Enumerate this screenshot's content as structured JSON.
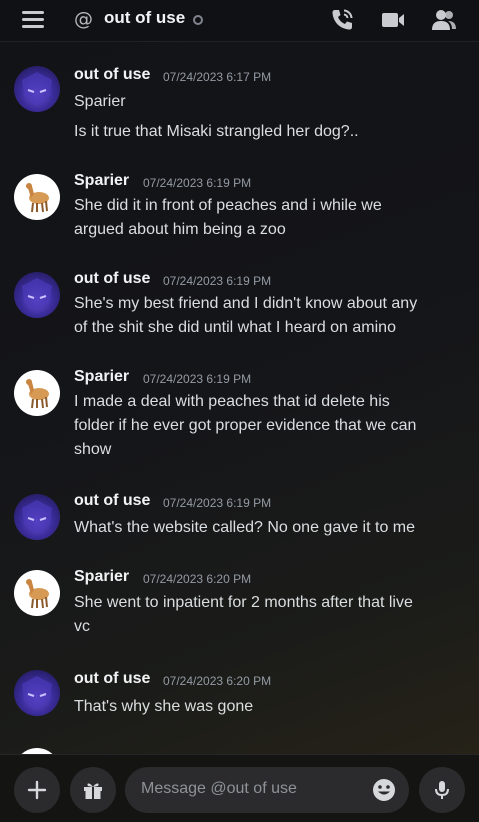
{
  "header": {
    "at_symbol": "@",
    "title": "out of use",
    "status": "offline",
    "icons": [
      "menu-icon",
      "call-icon",
      "video-icon",
      "members-icon"
    ]
  },
  "messages": [
    {
      "author": "out of use",
      "timestamp": "07/24/2023 6:17 PM",
      "avatar": "out-of-use-avatar",
      "lines": [
        "Sparier",
        "Is it true that Misaki strangled her dog?.."
      ]
    },
    {
      "author": "Sparier",
      "timestamp": "07/24/2023 6:19 PM",
      "avatar": "sparier-avatar",
      "lines": [
        "She did it in front of peaches and i while we",
        "argued about him being a zoo"
      ]
    },
    {
      "author": "out of use",
      "timestamp": "07/24/2023 6:19 PM",
      "avatar": "out-of-use-avatar",
      "lines": [
        "She's my best friend and I didn't know about any",
        "of the shit she did until what I heard on amino"
      ]
    },
    {
      "author": "Sparier",
      "timestamp": "07/24/2023 6:19 PM",
      "avatar": "sparier-avatar",
      "lines": [
        "I made a deal with peaches that id delete his",
        "folder if he ever got proper evidence that we can",
        "show"
      ]
    },
    {
      "author": "out of use",
      "timestamp": "07/24/2023 6:19 PM",
      "avatar": "out-of-use-avatar",
      "lines": [
        "What's the website called? No one gave it to me"
      ]
    },
    {
      "author": "Sparier",
      "timestamp": "07/24/2023 6:20 PM",
      "avatar": "sparier-avatar",
      "lines": [
        "She went to inpatient for 2 months after that live",
        "vc"
      ]
    },
    {
      "author": "out of use",
      "timestamp": "07/24/2023 6:20 PM",
      "avatar": "out-of-use-avatar",
      "lines": [
        "That's why she was gone"
      ]
    }
  ],
  "composer": {
    "placeholder": "Message @out of use",
    "icons": [
      "plus-icon",
      "gift-icon",
      "emoji-icon",
      "microphone-icon"
    ]
  },
  "colors": {
    "header_bg": "#111215",
    "text": "#dbdee1",
    "author": "#f2f3f5",
    "timestamp": "#949ba4",
    "input_bg": "#2b2b2e"
  }
}
